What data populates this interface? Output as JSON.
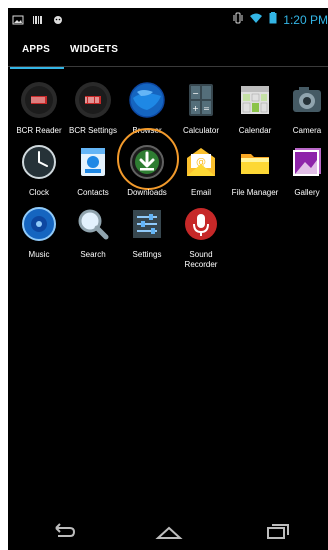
{
  "status_bar": {
    "time": "1:20 PM"
  },
  "tabs": [
    {
      "label": "APPS"
    },
    {
      "label": "WIDGETS"
    }
  ],
  "apps": [
    {
      "label": "BCR Reader",
      "icon": "bcr-reader-icon"
    },
    {
      "label": "BCR Settings",
      "icon": "bcr-settings-icon"
    },
    {
      "label": "Browser",
      "icon": "browser-globe-icon"
    },
    {
      "label": "Calculator",
      "icon": "calculator-icon"
    },
    {
      "label": "Calendar",
      "icon": "calendar-icon"
    },
    {
      "label": "Camera",
      "icon": "camera-icon"
    },
    {
      "label": "Clock",
      "icon": "clock-icon"
    },
    {
      "label": "Contacts",
      "icon": "contacts-icon"
    },
    {
      "label": "Downloads",
      "icon": "download-icon"
    },
    {
      "label": "Email",
      "icon": "email-icon"
    },
    {
      "label": "File Manager",
      "icon": "folder-icon"
    },
    {
      "label": "Gallery",
      "icon": "gallery-icon"
    },
    {
      "label": "Music",
      "icon": "music-icon"
    },
    {
      "label": "Search",
      "icon": "search-icon"
    },
    {
      "label": "Settings",
      "icon": "settings-icon"
    },
    {
      "label": "Sound Recorder",
      "icon": "microphone-icon"
    }
  ],
  "colors": {
    "accent": "#33b5e5",
    "highlight": "#f29a2c"
  }
}
